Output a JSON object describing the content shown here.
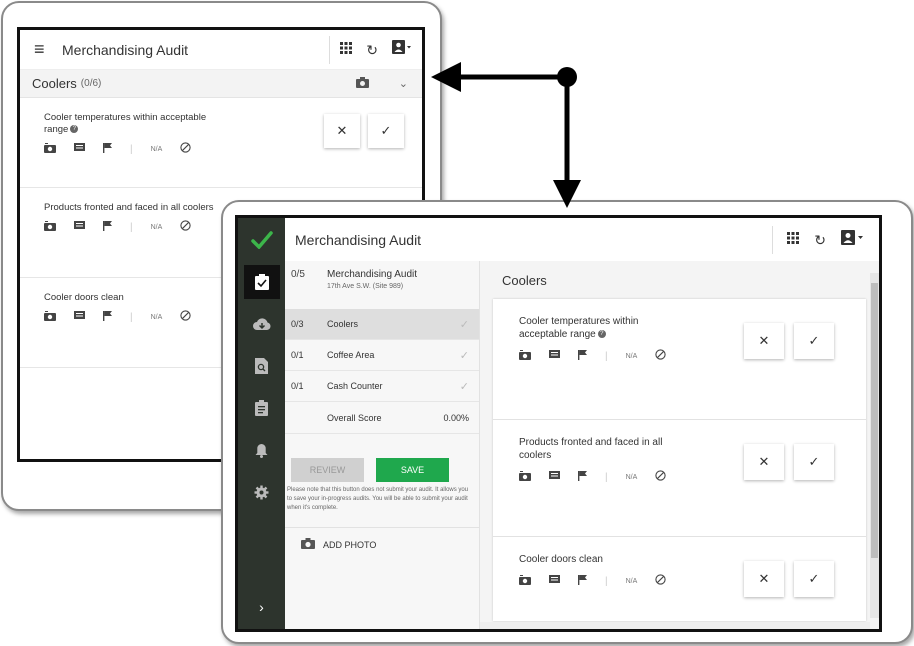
{
  "portrait": {
    "title": "Merchandising Audit",
    "section": {
      "name": "Coolers",
      "count": "(0/6)"
    },
    "items": [
      {
        "question": "Cooler temperatures within acceptable range",
        "help": true
      },
      {
        "question": "Products fronted and faced in all coolers",
        "help": false
      },
      {
        "question": "Cooler doors clean",
        "help": false
      }
    ]
  },
  "na_label": "N/A",
  "landscape": {
    "title": "Merchandising Audit",
    "nav": {
      "top": {
        "num": "0/5",
        "title": "Merchandising Audit",
        "subtitle": "17th Ave S.W. (Site 989)"
      },
      "rows": [
        {
          "num": "0/3",
          "label": "Coolers",
          "selected": true
        },
        {
          "num": "0/1",
          "label": "Coffee Area",
          "selected": false
        },
        {
          "num": "0/1",
          "label": "Cash Counter",
          "selected": false
        }
      ],
      "score_label": "Overall Score",
      "score_value": "0.00%",
      "review_label": "REVIEW",
      "save_label": "SAVE",
      "note": "Please note that this button does not submit your audit. It allows you to save your in-progress audits. You will be able to submit your audit when it's complete.",
      "add_photo_label": "ADD PHOTO"
    },
    "main": {
      "title": "Coolers",
      "items": [
        {
          "question": "Cooler temperatures within acceptable range",
          "help": true
        },
        {
          "question": "Products fronted and faced in all coolers",
          "help": false
        },
        {
          "question": "Cooler doors clean",
          "help": false
        }
      ]
    }
  },
  "colors": {
    "sidebar": "#2d342d",
    "save": "#1fa84d",
    "accent": "#3cb54a"
  },
  "icons": [
    "menu-icon",
    "apps-grid-icon",
    "refresh-icon",
    "account-icon",
    "camera-icon",
    "chevron-down-icon",
    "comment-icon",
    "flag-icon",
    "block-icon",
    "close-icon",
    "check-icon"
  ]
}
